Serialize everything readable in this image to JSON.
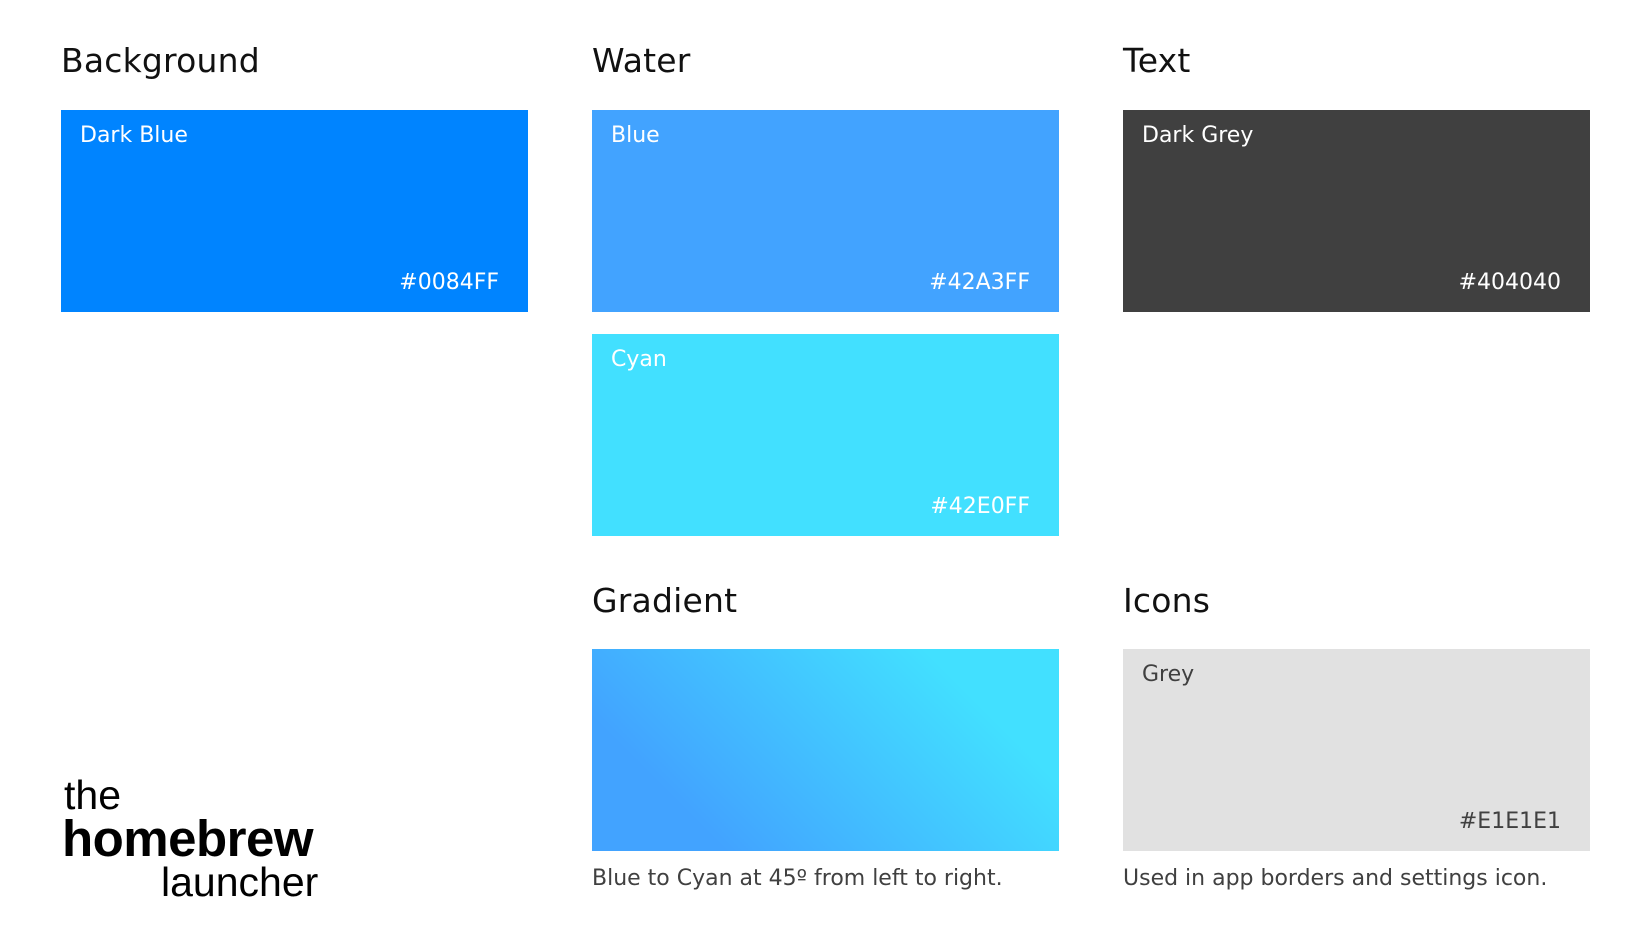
{
  "sections": {
    "background": {
      "heading": "Background",
      "swatch": {
        "name": "Dark Blue",
        "hex": "#0084FF",
        "color": "#0084FF"
      }
    },
    "water": {
      "heading": "Water",
      "swatches": [
        {
          "name": "Blue",
          "hex": "#42A3FF",
          "color": "#42A3FF"
        },
        {
          "name": "Cyan",
          "hex": "#42E0FF",
          "color": "#42E0FF"
        }
      ]
    },
    "text": {
      "heading": "Text",
      "swatch": {
        "name": "Dark Grey",
        "hex": "#404040",
        "color": "#404040"
      }
    },
    "gradient": {
      "heading": "Gradient",
      "from_color": "#42A3FF",
      "to_color": "#42E0FF",
      "caption": "Blue to Cyan at 45º from left to right."
    },
    "icons": {
      "heading": "Icons",
      "swatch": {
        "name": "Grey",
        "hex": "#E1E1E1",
        "color": "#E1E1E1"
      },
      "caption": "Used in app borders and settings icon."
    }
  },
  "logo": {
    "line1": "the",
    "line2": "homebrew",
    "line3": "launcher"
  }
}
